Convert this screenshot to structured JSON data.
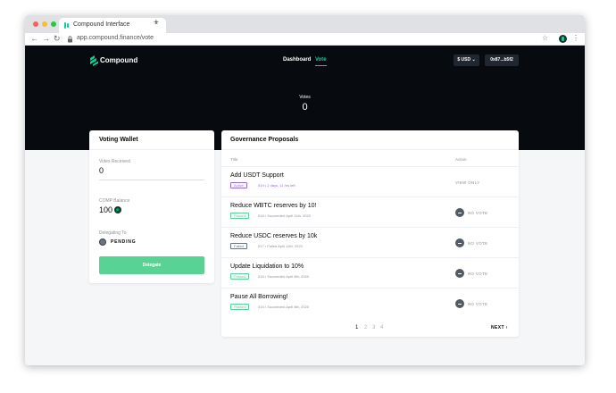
{
  "browser": {
    "tab_title": "Compound Interface",
    "tab_close": "×",
    "new_tab": "+",
    "url": "app.compound.finance/vote",
    "back": "←",
    "forward": "→",
    "reload": "↻",
    "bookmark": "☆",
    "menu": "⋮"
  },
  "header": {
    "brand": "Compound",
    "nav": {
      "dashboard": "Dashboard",
      "vote": "Vote"
    },
    "currency_button": "$ USD ⌄",
    "account_button": "0x87...b5f2",
    "votes_label": "Votes",
    "votes_value": "0"
  },
  "wallet": {
    "title": "Voting Wallet",
    "votes_received_label": "Votes Received",
    "votes_received_value": "0",
    "comp_balance_label": "COMP Balance",
    "comp_balance_value": "100",
    "delegating_to_label": "Delegating To",
    "delegating_to_value": "PENDING",
    "delegate_button": "Delegate"
  },
  "governance": {
    "title": "Governance Proposals",
    "columns": {
      "title": "Title",
      "action": "Action"
    },
    "proposals": [
      {
        "title": "Add USDT Support",
        "status": "Active",
        "meta": "019 • 2 days, 11 hrs left",
        "action": "VIEW ONLY"
      },
      {
        "title": "Reduce WBTC reserves by 10!",
        "status": "Passed",
        "meta": "018 • Succeeded April 11th, 2020",
        "action": "NO VOTE"
      },
      {
        "title": "Reduce USDC reserves by 10k",
        "status": "Failed",
        "meta": "017 • Failed April 11th, 2020",
        "action": "NO VOTE"
      },
      {
        "title": "Update Liquidation to 10%",
        "status": "Passed",
        "meta": "016 • Succeeded April 8th, 2020",
        "action": "NO VOTE"
      },
      {
        "title": "Pause All Borrowing!",
        "status": "Passed",
        "meta": "015 • Succeeded April 8th, 2020",
        "action": "NO VOTE"
      }
    ],
    "pagination": {
      "pages": [
        "1",
        "2",
        "3",
        "4"
      ],
      "current": "1",
      "next": "NEXT ›"
    }
  },
  "colors": {
    "brand_green": "#00d395",
    "button_green": "#58d394",
    "active_purple": "#9669ed",
    "header_bg": "#070a0e"
  },
  "icons": {
    "logo": "compound-logo-icon",
    "comp_token": "comp-token-icon",
    "delegate_avatar": "avatar-icon",
    "no_vote": "minus-circle-icon",
    "lock": "lock-icon"
  }
}
